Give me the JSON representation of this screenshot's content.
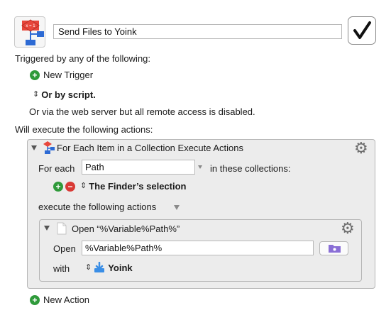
{
  "macro": {
    "name": "Send Files to Yoink",
    "enabled": true,
    "icon": "flowchart-icon",
    "enabled_icon": "checkmark-icon"
  },
  "triggers": {
    "heading": "Triggered by any of the following:",
    "new_trigger": "New Trigger",
    "or_by_script": "Or by script.",
    "web_server_note": "Or via the web server but all remote access is disabled."
  },
  "actions": {
    "heading": "Will execute the following actions:",
    "for_each": {
      "title": "For Each Item in a Collection Execute Actions",
      "for_each_label": "For each",
      "variable_value": "Path",
      "collections_label": "in these collections:",
      "collection": "The Finder’s selection",
      "execute_label": "execute the following actions",
      "open_action": {
        "title": "Open “%Variable%Path%”",
        "open_label": "Open",
        "open_value": "%Variable%Path%",
        "with_label": "with",
        "app": "Yoink"
      }
    },
    "new_action": "New Action"
  },
  "colors": {
    "add_green": "#2f9a3a",
    "remove_red": "#d93a35",
    "action_group_bg": "#ececec",
    "folder_purple": "#8a6fd6"
  }
}
